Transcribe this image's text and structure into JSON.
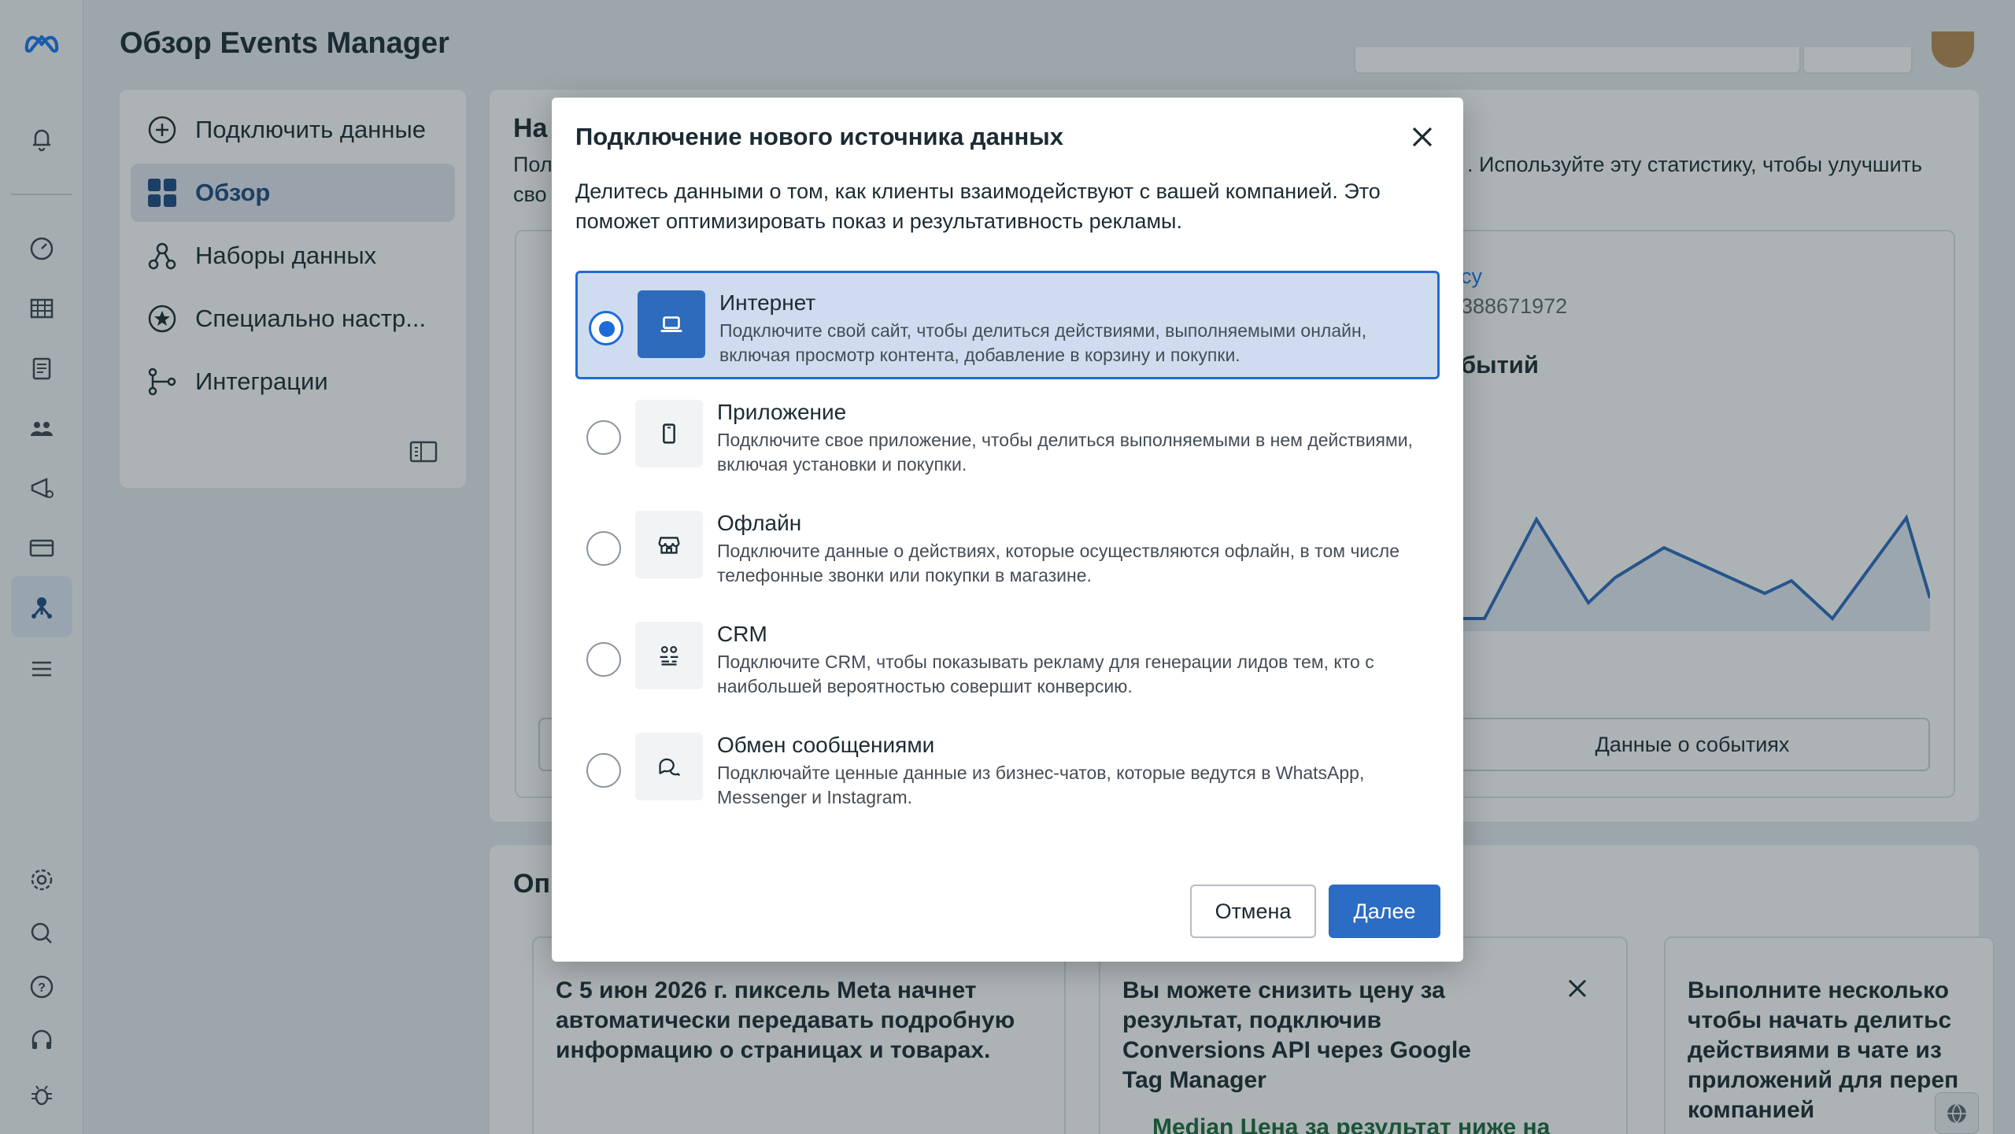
{
  "header": {
    "title": "Обзор Events Manager"
  },
  "nav": {
    "items": [
      {
        "label": "Подключить данные",
        "icon": "plus-circle-icon"
      },
      {
        "label": "Обзор",
        "icon": "overview-grid-icon",
        "active": true
      },
      {
        "label": "Наборы данных",
        "icon": "datasets-icon"
      },
      {
        "label": "Специально настр...",
        "icon": "star-circle-icon"
      },
      {
        "label": "Интеграции",
        "icon": "integrations-icon"
      }
    ]
  },
  "main": {
    "heading": "На",
    "desc_left": "Пол",
    "desc_left2": "сво",
    "desc_right": ". Используйте эту статистику, чтобы улучшить",
    "dataset_link": "су",
    "dataset_id": "388671972",
    "events_heading": "бытий",
    "events_button": "Данные о событиях",
    "chart_color": "#2d6bbd"
  },
  "lower": {
    "heading": "Оп",
    "tips": [
      {
        "text": "С 5 июн 2026 г. пиксель Meta начнет автоматически передавать подробную информацию о страницах и товарах."
      },
      {
        "text": "Вы можете снизить цену за результат, подключив Conversions API через Google Tag Manager",
        "sub": "Median Цена за результат ниже на"
      },
      {
        "text": "Выполните несколько чтобы начать делитьс действиями в чате из приложений для переп компанией"
      }
    ]
  },
  "modal": {
    "title": "Подключение нового источника данных",
    "description": "Делитесь данными о том, как клиенты взаимодействуют с вашей компанией. Это поможет оптимизировать показ и результативность рекламы.",
    "options": [
      {
        "title": "Интернет",
        "desc": "Подключите свой сайт, чтобы делиться действиями, выполняемыми онлайн, включая просмотр контента, добавление в корзину и покупки.",
        "icon": "laptop-icon",
        "selected": true
      },
      {
        "title": "Приложение",
        "desc": "Подключите свое приложение, чтобы делиться выполняемыми в нем действиями, включая установки и покупки.",
        "icon": "mobile-phone-icon",
        "selected": false
      },
      {
        "title": "Офлайн",
        "desc": "Подключите данные о действиях, которые осуществляются офлайн, в том числе телефонные звонки или покупки в магазине.",
        "icon": "storefront-icon",
        "selected": false
      },
      {
        "title": "CRM",
        "desc": "Подключите CRM, чтобы показывать рекламу для генерации лидов тем, кто с наибольшей вероятностью совершит конверсию.",
        "icon": "crm-people-icon",
        "selected": false
      },
      {
        "title": "Обмен сообщениями",
        "desc": "Подключайте ценные данные из бизнес-чатов, которые ведутся в WhatsApp, Messenger и Instagram.",
        "icon": "chat-bubbles-icon",
        "selected": false
      }
    ],
    "cancel_label": "Отмена",
    "next_label": "Далее"
  },
  "colors": {
    "accent": "#2b6cc4",
    "selected_bg": "#cfdcf0"
  }
}
